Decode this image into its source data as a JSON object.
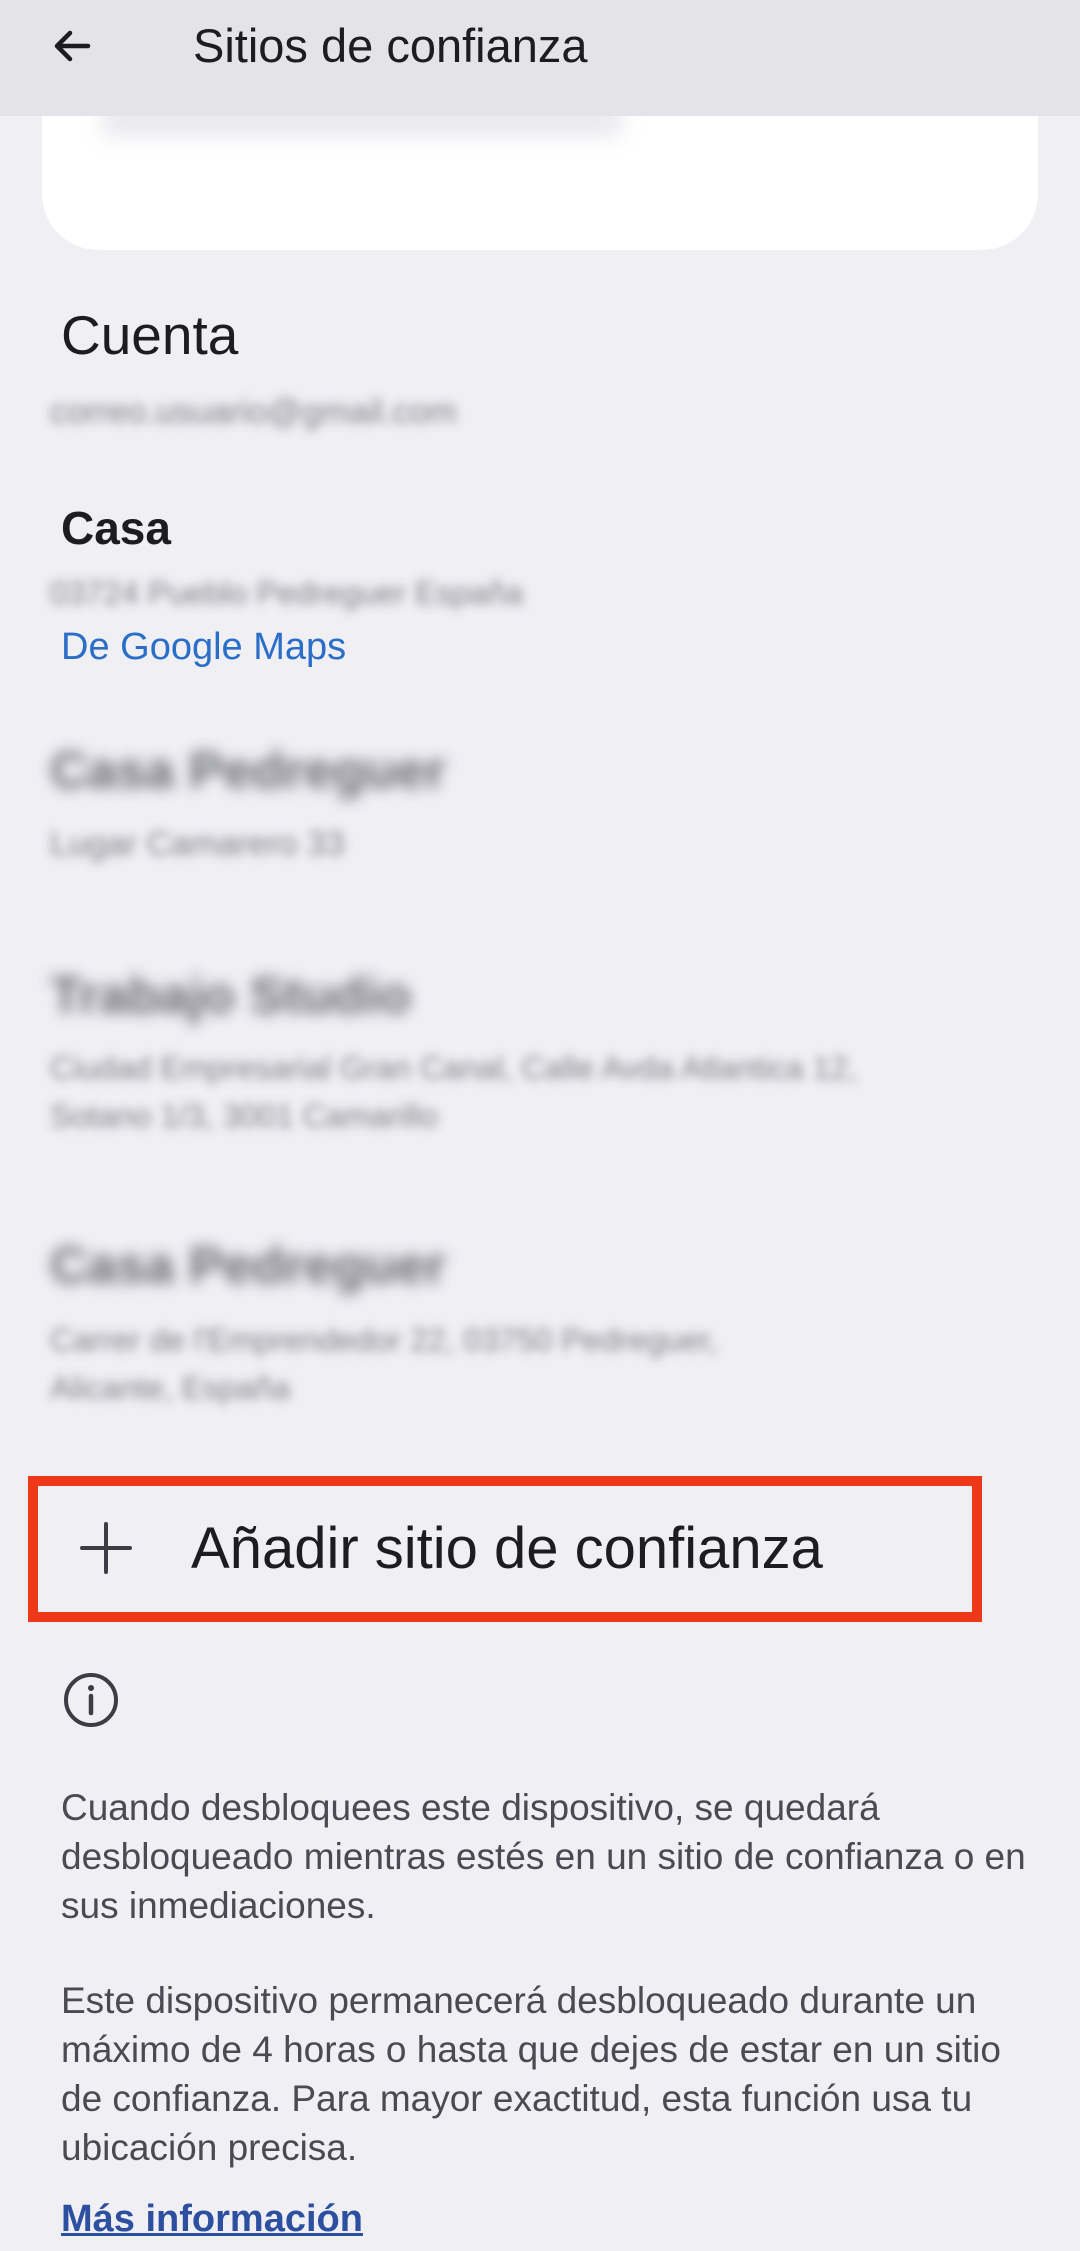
{
  "app_bar": {
    "title": "Sitios de confianza",
    "back_icon": "arrow-back-icon"
  },
  "account": {
    "heading": "Cuenta",
    "email": "correo.usuario@gmail.com"
  },
  "home": {
    "name": "Casa",
    "address": "03724 Pueblo Pedreguer España",
    "source": "De Google Maps"
  },
  "trusted_places": [
    {
      "name": "Casa Pedreguer",
      "address": "Lugar Camarero 33"
    },
    {
      "name": "Trabajo Studio",
      "address_lines": [
        "Ciudad Empresarial Gran Canal, Calle Avda Atlantica 12,",
        "Sotano 1/3, 3001 Camarillo"
      ]
    },
    {
      "name": "Casa Pedreguer",
      "address_lines": [
        "Carrer de l'Emprendedor 22, 03750 Pedreguer,",
        "Alicante, España"
      ]
    }
  ],
  "add_place": {
    "label": "Añadir sitio de confianza",
    "icon": "plus-icon",
    "highlight_color": "#ee3918"
  },
  "info": {
    "icon": "info-icon",
    "paragraph_1": "Cuando desbloquees este dispositivo, se quedará desbloqueado mientras estés en un sitio de confianza o en sus inmediaciones.",
    "paragraph_2": "Este dispositivo permanecerá desbloqueado durante un máximo de 4 horas o hasta que dejes de estar en un sitio de confianza. Para mayor exactitud, esta función usa tu ubicación precisa.",
    "more_link": "Más información"
  },
  "colors": {
    "background": "#efeff4",
    "app_bar": "#e4e4e8",
    "link": "#2a6ec8"
  }
}
